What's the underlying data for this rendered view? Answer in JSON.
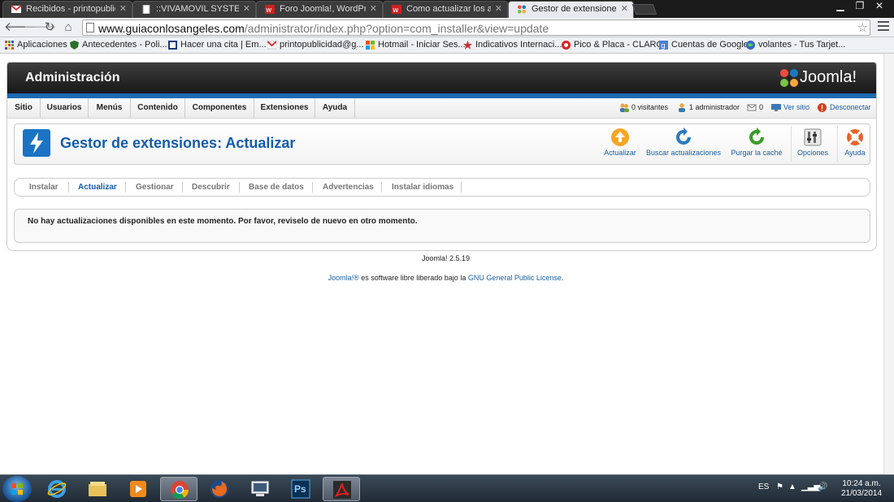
{
  "browser": {
    "tabs": [
      {
        "label": "Recibidos - printopublicid",
        "icon": "gmail-icon",
        "active": false
      },
      {
        "label": "::VIVAMOVIL SYSTEM::",
        "icon": "page-icon",
        "active": false
      },
      {
        "label": "Foro Joomla!, WordPress",
        "icon": "w-site-icon",
        "active": false
      },
      {
        "label": "Como actualizar los archi",
        "icon": "w-site-icon",
        "active": false
      },
      {
        "label": "Gestor de extensiones - Ac",
        "icon": "joomla-icon",
        "active": true
      }
    ],
    "url_host": "www.guiaconlosangeles.com",
    "url_path": "/administrator/index.php?option=com_installer&view=update",
    "bookmarks": [
      {
        "label": "Aplicaciones",
        "icon": "apps-grid-icon",
        "color": "#d44"
      },
      {
        "label": "Antecedentes - Poli...",
        "icon": "shield-icon",
        "color": "#2a6f2a"
      },
      {
        "label": "Hacer una cita | Em...",
        "icon": "document-icon",
        "color": "#36c"
      },
      {
        "label": "printopublicidad@g...",
        "icon": "gmail-icon",
        "color": "#d44"
      },
      {
        "label": "Hotmail - Iniciar Ses...",
        "icon": "windows-icon",
        "color": "#e80"
      },
      {
        "label": "Indicativos Internaci...",
        "icon": "star-icon",
        "color": "#c33"
      },
      {
        "label": "Pico & Placa - CLARO",
        "icon": "claro-icon",
        "color": "#d22"
      },
      {
        "label": "Cuentas de Google",
        "icon": "google-icon",
        "color": "#4a7fd6"
      },
      {
        "label": "volantes - Tus Tarjet...",
        "icon": "globe-icon",
        "color": "#36c"
      }
    ]
  },
  "header": {
    "title": "Administración",
    "logo_text": "Joomla!"
  },
  "menu": {
    "items": [
      "Sitio",
      "Usuarios",
      "Menús",
      "Contenido",
      "Componentes",
      "Extensiones",
      "Ayuda"
    ],
    "status": {
      "visitors": "0 visitantes",
      "admins": "1 administrador",
      "messages": "0",
      "view_site": "Ver sitio",
      "logout": "Desconectar"
    }
  },
  "toolbar": {
    "title": "Gestor de extensiones: Actualizar",
    "buttons": [
      {
        "label": "Actualizar",
        "icon": "upload-arrow-icon"
      },
      {
        "label": "Buscar actualizaciones",
        "icon": "refresh-icon"
      },
      {
        "label": "Purgar la caché",
        "icon": "refresh-green-icon"
      },
      {
        "label": "Opciones",
        "icon": "options-icon"
      },
      {
        "label": "Ayuda",
        "icon": "help-lifebuoy-icon"
      }
    ]
  },
  "submenu": {
    "items": [
      "Instalar",
      "Actualizar",
      "Gestionar",
      "Descubrir",
      "Base de datos",
      "Advertencias",
      "Instalar idiomas"
    ],
    "active": "Actualizar"
  },
  "message": "No hay actualizaciones disponibles en este momento. Por favor, reviselo de nuevo en otro momento.",
  "footer": {
    "version": "Joomla! 2.5.19",
    "license_link1": "Joomla!®",
    "license_text": " es software libre liberado bajo la ",
    "license_link2": "GNU General Public License",
    "license_end": "."
  },
  "taskbar": {
    "apps": [
      "internet-explorer-icon",
      "file-explorer-icon",
      "media-player-icon",
      "chrome-icon",
      "firefox-icon",
      "network-window-icon",
      "photoshop-icon",
      "acrobat-icon"
    ],
    "photoshop_label": "Ps",
    "language": "ES",
    "time": "10:24 a.m.",
    "date": "21/03/2014"
  },
  "colors": {
    "joomla_blue": "#135cae",
    "header_dark": "#1f1f1f",
    "accent_bar": "#1a6ab0"
  }
}
